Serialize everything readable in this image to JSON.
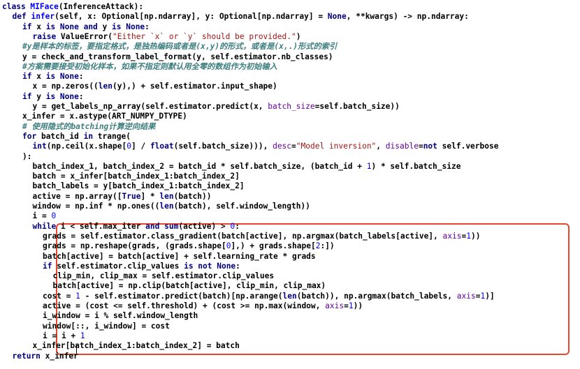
{
  "editor": {
    "language": "python",
    "highlight_color": "#e8472c",
    "lines": [
      {
        "indent": 0,
        "tokens": [
          [
            "kw",
            "class "
          ],
          [
            "cls",
            "MIFace"
          ],
          [
            "plain",
            "(InferenceAttack):"
          ]
        ]
      },
      {
        "indent": 1,
        "tokens": [
          [
            "kw",
            "def "
          ],
          [
            "cls",
            "infer"
          ],
          [
            "plain",
            "(self, x: Optional[np.ndarray], y: Optional[np.ndarray] = "
          ],
          [
            "kw",
            "None"
          ],
          [
            "plain",
            ", **kwargs) -> np.ndarray:"
          ]
        ]
      },
      {
        "indent": 2,
        "tokens": [
          [
            "kw",
            "if "
          ],
          [
            "plain",
            "x "
          ],
          [
            "kw",
            "is None and "
          ],
          [
            "plain",
            "y "
          ],
          [
            "kw",
            "is None"
          ],
          [
            "plain",
            ":"
          ]
        ]
      },
      {
        "indent": 3,
        "tokens": [
          [
            "kw",
            "raise "
          ],
          [
            "plain",
            "ValueError("
          ],
          [
            "str",
            "\"Either `x` or `y` should be provided.\""
          ],
          [
            "plain",
            ")"
          ]
        ]
      },
      {
        "indent": 2,
        "tokens": [
          [
            "cm",
            "#y是样本的标签，要指定格式，是独热编码或者是(x,y)的形式，或者是(x,.)形式的索引"
          ]
        ]
      },
      {
        "indent": 2,
        "tokens": [
          [
            "plain",
            "y = check_and_transform_label_format(y, self.estimator.nb_classes)"
          ]
        ]
      },
      {
        "indent": 2,
        "tokens": [
          [
            "cm",
            "#方案需要接受初始化样本，如果不指定则默认用全零的数组作为初始输入"
          ]
        ]
      },
      {
        "indent": 2,
        "tokens": [
          [
            "kw",
            "if "
          ],
          [
            "plain",
            "x "
          ],
          [
            "kw",
            "is None"
          ],
          [
            "plain",
            ":"
          ]
        ]
      },
      {
        "indent": 3,
        "tokens": [
          [
            "plain",
            "x = np.zeros(("
          ],
          [
            "kw",
            "len"
          ],
          [
            "plain",
            "(y),) + self.estimator.input_shape)"
          ]
        ]
      },
      {
        "indent": 2,
        "tokens": [
          [
            "kw",
            "if "
          ],
          [
            "plain",
            "y "
          ],
          [
            "kw",
            "is None"
          ],
          [
            "plain",
            ":"
          ]
        ]
      },
      {
        "indent": 3,
        "tokens": [
          [
            "plain",
            "y = get_labels_np_array(self.estimator.predict(x, "
          ],
          [
            "kwarg",
            "batch_size"
          ],
          [
            "plain",
            "=self.batch_size))"
          ]
        ]
      },
      {
        "indent": 2,
        "tokens": [
          [
            "plain",
            "x_infer = x.astype(ART_NUMPY_DTYPE)"
          ]
        ]
      },
      {
        "indent": 2,
        "tokens": [
          [
            "cm",
            "# 使用隐式的batching计算逆向结果"
          ]
        ]
      },
      {
        "indent": 2,
        "tokens": [
          [
            "kw",
            "for "
          ],
          [
            "plain",
            "batch_id "
          ],
          [
            "kw",
            "in "
          ],
          [
            "plain",
            "trange("
          ]
        ]
      },
      {
        "indent": 3,
        "tokens": [
          [
            "kw",
            "int"
          ],
          [
            "plain",
            "(np.ceil(x.shape["
          ],
          [
            "num",
            "0"
          ],
          [
            "plain",
            "] / "
          ],
          [
            "kw",
            "float"
          ],
          [
            "plain",
            "(self.batch_size))), "
          ],
          [
            "kwarg",
            "desc"
          ],
          [
            "plain",
            "="
          ],
          [
            "str",
            "\"Model inversion\""
          ],
          [
            "plain",
            ", "
          ],
          [
            "kwarg",
            "disable"
          ],
          [
            "plain",
            "="
          ],
          [
            "kw",
            "not "
          ],
          [
            "plain",
            "self.verbose"
          ]
        ]
      },
      {
        "indent": 2,
        "tokens": [
          [
            "plain",
            "):"
          ]
        ]
      },
      {
        "indent": 3,
        "tokens": [
          [
            "plain",
            "batch_index_1, batch_index_2 = batch_id * self.batch_size, (batch_id + "
          ],
          [
            "num",
            "1"
          ],
          [
            "plain",
            ") * self.batch_size"
          ]
        ]
      },
      {
        "indent": 3,
        "tokens": [
          [
            "plain",
            "batch = x_infer[batch_index_1:batch_index_2]"
          ]
        ]
      },
      {
        "indent": 3,
        "tokens": [
          [
            "plain",
            "batch_labels = y[batch_index_1:batch_index_2]"
          ]
        ]
      },
      {
        "indent": 3,
        "tokens": [
          [
            "plain",
            "active = np.array(["
          ],
          [
            "kw",
            "True"
          ],
          [
            "plain",
            "] * "
          ],
          [
            "kw",
            "len"
          ],
          [
            "plain",
            "(batch))"
          ]
        ]
      },
      {
        "indent": 3,
        "tokens": [
          [
            "plain",
            "window = np.inf * np.ones(("
          ],
          [
            "kw",
            "len"
          ],
          [
            "plain",
            "(batch), self.window_length))"
          ]
        ]
      },
      {
        "indent": 3,
        "tokens": [
          [
            "plain",
            "i = "
          ],
          [
            "num",
            "0"
          ]
        ]
      },
      {
        "indent": 3,
        "tokens": [
          [
            "kw",
            "while "
          ],
          [
            "plain",
            "i < self.max_iter "
          ],
          [
            "kw",
            "and "
          ],
          [
            "kw",
            "sum"
          ],
          [
            "plain",
            "(active) > "
          ],
          [
            "num",
            "0"
          ],
          [
            "plain",
            ":"
          ]
        ]
      },
      {
        "indent": 4,
        "tokens": [
          [
            "plain",
            "grads = self.estimator.class_gradient(batch[active], np.argmax(batch_labels[active], "
          ],
          [
            "kwarg",
            "axis"
          ],
          [
            "plain",
            "="
          ],
          [
            "num",
            "1"
          ],
          [
            "plain",
            "))"
          ]
        ]
      },
      {
        "indent": 4,
        "tokens": [
          [
            "plain",
            "grads = np.reshape(grads, (grads.shape["
          ],
          [
            "num",
            "0"
          ],
          [
            "plain",
            "],) + grads.shape["
          ],
          [
            "num",
            "2"
          ],
          [
            "plain",
            ":])"
          ]
        ]
      },
      {
        "indent": 4,
        "tokens": [
          [
            "plain",
            "batch[active] = batch[active] + self.learning_rate * grads"
          ]
        ]
      },
      {
        "indent": 4,
        "tokens": [
          [
            "kw",
            "if "
          ],
          [
            "plain",
            "self.estimator.clip_values "
          ],
          [
            "kw",
            "is not None"
          ],
          [
            "plain",
            ":"
          ]
        ]
      },
      {
        "indent": 5,
        "tokens": [
          [
            "plain",
            "clip_min, clip_max = self.estimator.clip_values"
          ]
        ]
      },
      {
        "indent": 5,
        "tokens": [
          [
            "plain",
            "batch[active] = np.clip(batch[active], clip_min, clip_max)"
          ]
        ]
      },
      {
        "indent": 4,
        "tokens": [
          [
            "plain",
            "cost = "
          ],
          [
            "num",
            "1"
          ],
          [
            "plain",
            " - self.estimator.predict(batch)[np.arange("
          ],
          [
            "kw",
            "len"
          ],
          [
            "plain",
            "(batch)), np.argmax(batch_labels, "
          ],
          [
            "kwarg",
            "axis"
          ],
          [
            "plain",
            "="
          ],
          [
            "num",
            "1"
          ],
          [
            "plain",
            ")]"
          ]
        ]
      },
      {
        "indent": 4,
        "tokens": [
          [
            "plain",
            "active = (cost <= self.threshold) + (cost >= np.max(window, "
          ],
          [
            "kwarg",
            "axis"
          ],
          [
            "plain",
            "="
          ],
          [
            "num",
            "1"
          ],
          [
            "plain",
            "))"
          ]
        ]
      },
      {
        "indent": 4,
        "tokens": [
          [
            "plain",
            "i_window = i % self.window_length"
          ]
        ]
      },
      {
        "indent": 4,
        "tokens": [
          [
            "plain",
            "window[::, i_window] = cost"
          ]
        ]
      },
      {
        "indent": 4,
        "tokens": [
          [
            "plain",
            "i = i + "
          ],
          [
            "num",
            "1"
          ]
        ]
      },
      {
        "indent": 3,
        "tokens": [
          [
            "plain",
            "x_infer[batch_index_1:batch_index_2] = batch"
          ]
        ]
      },
      {
        "indent": 1,
        "tokens": [
          [
            "kw",
            "return "
          ],
          [
            "plain",
            "x_infer"
          ]
        ]
      }
    ]
  }
}
